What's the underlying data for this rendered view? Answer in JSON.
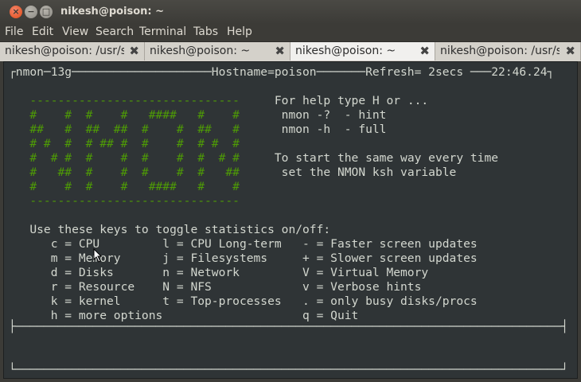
{
  "window": {
    "title": "nikesh@poison: ~"
  },
  "menu": [
    "File",
    "Edit",
    "View",
    "Search",
    "Terminal",
    "Tabs",
    "Help"
  ],
  "tabs": [
    {
      "label": "nikesh@poison: /usr/share/",
      "active": false
    },
    {
      "label": "nikesh@poison: ~",
      "active": false
    },
    {
      "label": "nikesh@poison: ~",
      "active": true
    },
    {
      "label": "nikesh@poison: /usr/share/",
      "active": false
    }
  ],
  "terminal": {
    "header": "┌nmon─13g────────────────────Hostname=poison───────Refresh= 2secs ───22:46.24┐",
    "lines": [
      {
        "g": "   ------------------------------",
        "w": "     For help type H or ..."
      },
      {
        "g": "   #    #  #    #   ####   #    #",
        "w": "      nmon -?  - hint"
      },
      {
        "g": "   ##   #  ##  ##  #    #  ##   #",
        "w": "      nmon -h  - full"
      },
      {
        "g": "   # #  #  # ## #  #    #  # #  #",
        "w": ""
      },
      {
        "g": "   #  # #  #    #  #    #  #  # #",
        "w": "     To start the same way every time"
      },
      {
        "g": "   #   ##  #    #  #    #  #   ##",
        "w": "      set the NMON ksh variable"
      },
      {
        "g": "   #    #  #    #   ####   #    #",
        "w": ""
      },
      {
        "g": "   ------------------------------",
        "w": ""
      }
    ],
    "keys_title": "   Use these keys to toggle statistics on/off:",
    "keys": [
      "      c = CPU         l = CPU Long-term   - = Faster screen updates",
      "      m = Memory      j = Filesystems     + = Slower screen updates",
      "      d = Disks       n = Network         V = Virtual Memory",
      "      r = Resource    N = NFS             v = Verbose hints",
      "      k = kernel      t = Top-processes   . = only busy disks/procs",
      "      h = more options                    q = Quit"
    ],
    "divider": "├──────────────────────────────────────────────────────────────────────────────┤",
    "footer": "└──────────────────────────────────────────────────────────────────────────────┘"
  }
}
